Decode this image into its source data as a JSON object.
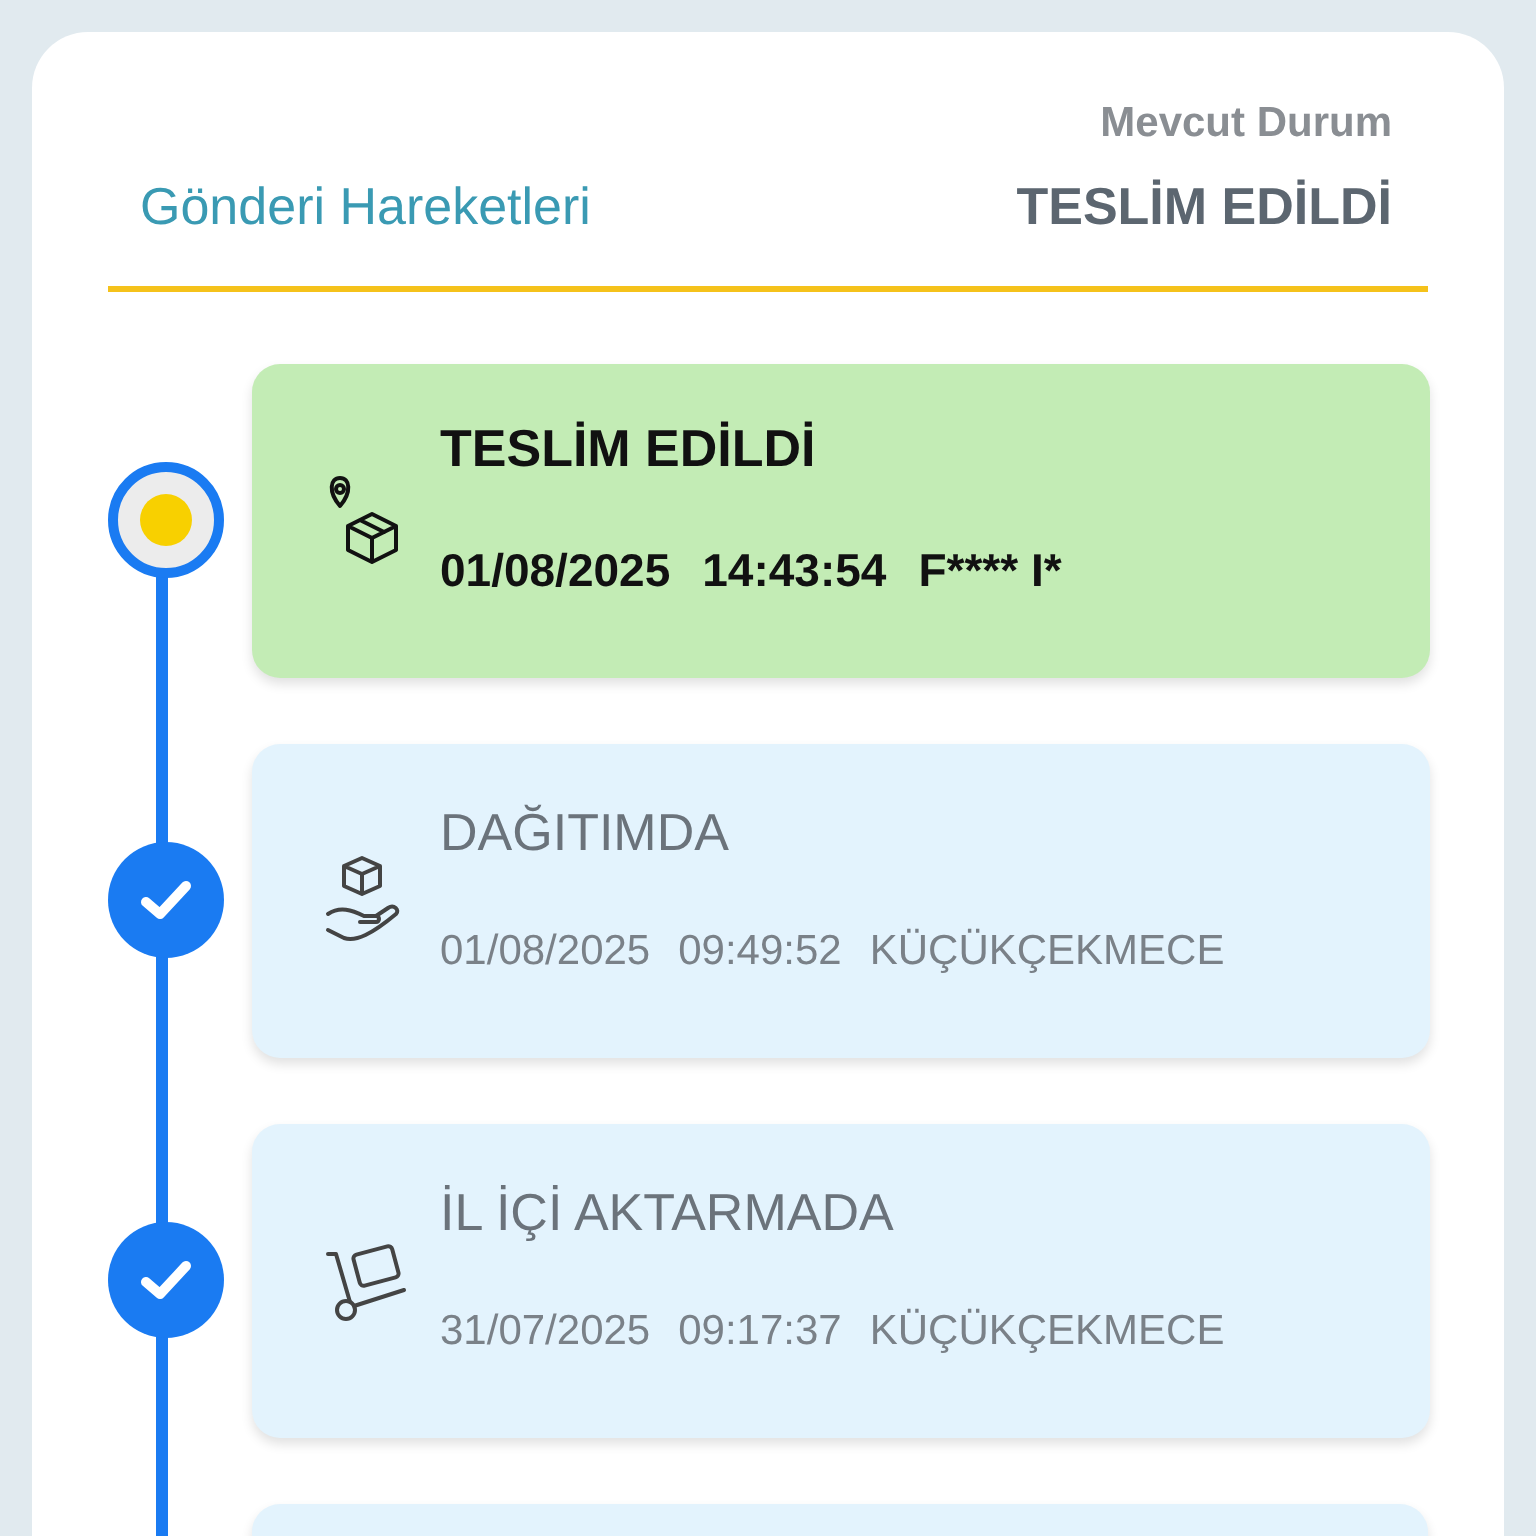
{
  "header": {
    "title": "Gönderi Hareketleri",
    "status_label": "Mevcut Durum",
    "status_value": "TESLİM EDİLDİ"
  },
  "events": [
    {
      "kind": "current",
      "title": "TESLİM EDİLDİ",
      "date": "01/08/2025",
      "time": "14:43:54",
      "place": "F**** I*"
    },
    {
      "kind": "done",
      "title": "DAĞITIMDA",
      "date": "01/08/2025",
      "time": "09:49:52",
      "place": "KÜÇÜKÇEKMECE"
    },
    {
      "kind": "done",
      "title": "İL İÇİ AKTARMADA",
      "date": "31/07/2025",
      "time": "09:17:37",
      "place": "KÜÇÜKÇEKMECE"
    }
  ]
}
